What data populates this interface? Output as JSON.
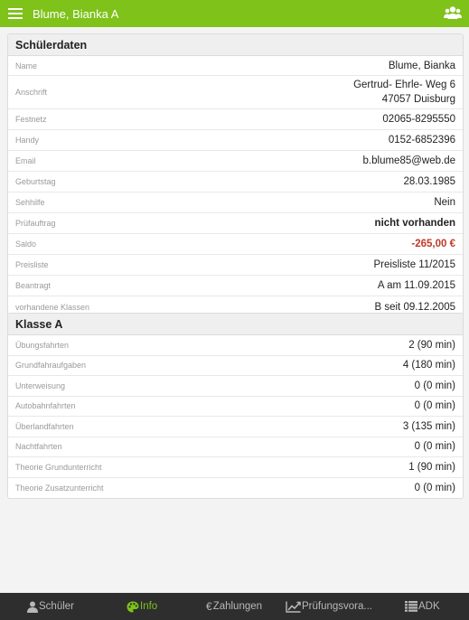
{
  "header": {
    "title": "Blume, Bianka A",
    "bar_color": "#7ec21a",
    "menu_icon": "hamburger-menu-icon",
    "users_icon": "users-group-icon"
  },
  "student": {
    "heading": "Schülerdaten",
    "rows": [
      {
        "label": "Name",
        "value": "Blume, Bianka"
      },
      {
        "label": "Anschrift",
        "value_line1": "Gertrud- Ehrle- Weg 6",
        "value_line2": "47057 Duisburg"
      },
      {
        "label": "Festnetz",
        "value": "02065-8295550"
      },
      {
        "label": "Handy",
        "value": "0152-6852396"
      },
      {
        "label": "Email",
        "value": "b.blume85@web.de"
      },
      {
        "label": "Geburtstag",
        "value": "28.03.1985"
      },
      {
        "label": "Sehhilfe",
        "value": "Nein"
      },
      {
        "label": "Prüfauftrag",
        "value": "nicht vorhanden"
      },
      {
        "label": "Saldo",
        "value": "-265,00 €"
      },
      {
        "label": "Preisliste",
        "value": "Preisliste 11/2015"
      },
      {
        "label": "Beantragt",
        "value": "A am 11.09.2015"
      },
      {
        "label": "vorhandene Klassen",
        "value": "B seit 09.12.2005"
      }
    ]
  },
  "class_a": {
    "heading": "Klasse A",
    "rows": [
      {
        "label": "Übungsfahrten",
        "value": "2 (90 min)"
      },
      {
        "label": "Grundfahraufgaben",
        "value": "4 (180 min)"
      },
      {
        "label": "Unterweisung",
        "value": "0 (0 min)"
      },
      {
        "label": "Autobahnfahrten",
        "value": "0 (0 min)"
      },
      {
        "label": "Überlandfahrten",
        "value": "3 (135 min)"
      },
      {
        "label": "Nachtfahrten",
        "value": "0 (0 min)"
      },
      {
        "label": "Theorie Grundunterricht",
        "value": "1 (90 min)"
      },
      {
        "label": "Theorie Zusatzunterricht",
        "value": "0 (0 min)"
      }
    ]
  },
  "tabs": {
    "schueler": {
      "label": "Schüler",
      "icon": "person-icon"
    },
    "info": {
      "label": "Info",
      "icon": "palette-icon",
      "active": true
    },
    "zahlungen": {
      "label": "Zahlungen",
      "glyph": "€",
      "icon": "euro-icon"
    },
    "pruefung": {
      "label": "Prüfungsvora...",
      "icon": "trend-chart-icon"
    },
    "adk": {
      "label": "ADK",
      "icon": "list-icon"
    }
  },
  "colors": {
    "accent": "#7ec21a",
    "negative": "#c0392b",
    "tabbar": "#2e2e2e"
  }
}
